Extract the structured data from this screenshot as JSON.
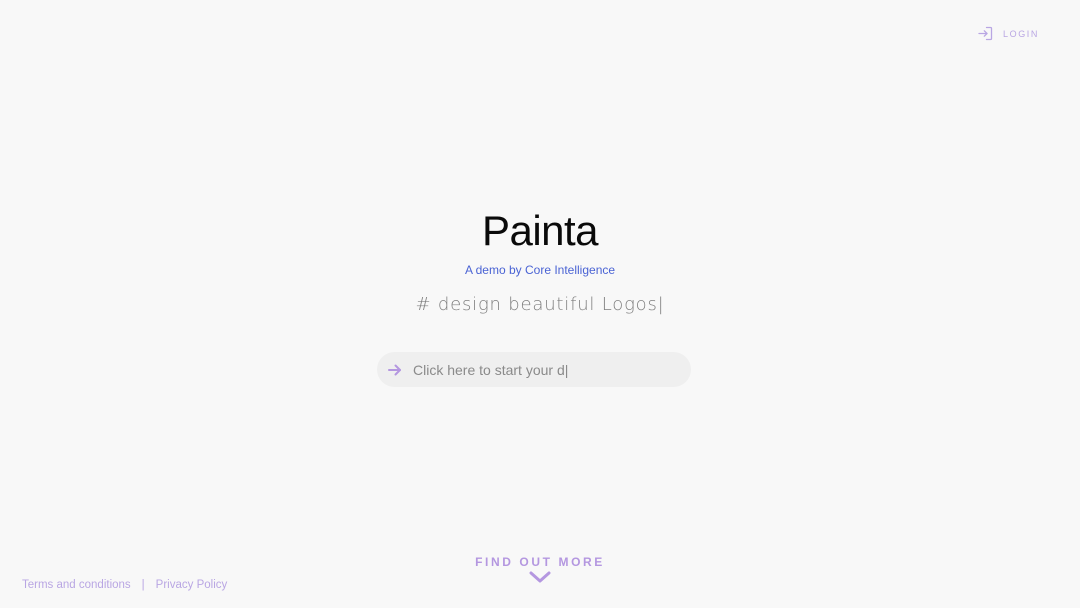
{
  "header": {
    "login_label": "LOGIN",
    "login_icon": "sign-in-icon"
  },
  "hero": {
    "title": "Painta",
    "subtitle": "A demo by Core Intelligence",
    "typed_text": "# design beautiful Logos|"
  },
  "search": {
    "icon": "arrow-right-icon",
    "value": "Click here to start your d|"
  },
  "find_more": {
    "label": "FIND OUT MORE",
    "icon": "chevron-down-icon"
  },
  "footer": {
    "terms_label": "Terms and conditions",
    "separator": "|",
    "privacy_label": "Privacy Policy"
  },
  "colors": {
    "background": "#f8f8f8",
    "accent": "#b497e0",
    "link_blue": "#4a63d4",
    "title": "#0a0a0a"
  }
}
